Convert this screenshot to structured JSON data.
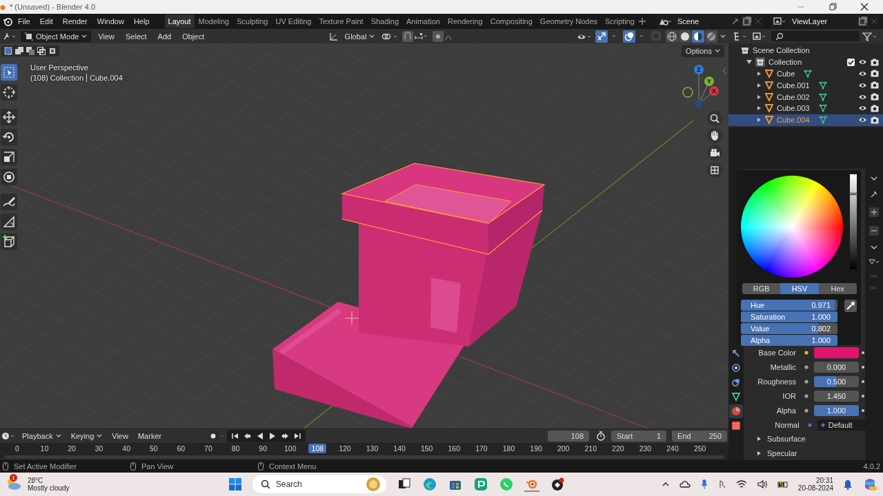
{
  "window": {
    "title": "* (Unsaved) - Blender 4.0"
  },
  "menus": [
    "File",
    "Edit",
    "Render",
    "Window",
    "Help"
  ],
  "workspaces": [
    {
      "label": "Layout",
      "selected": true
    },
    {
      "label": "Modeling",
      "selected": false
    },
    {
      "label": "Sculpting",
      "selected": false
    },
    {
      "label": "UV Editing",
      "selected": false
    },
    {
      "label": "Texture Paint",
      "selected": false
    },
    {
      "label": "Shading",
      "selected": false
    },
    {
      "label": "Animation",
      "selected": false
    },
    {
      "label": "Rendering",
      "selected": false
    },
    {
      "label": "Compositing",
      "selected": false
    },
    {
      "label": "Geometry Nodes",
      "selected": false
    },
    {
      "label": "Scripting",
      "selected": false
    }
  ],
  "scene": "Scene",
  "view_layer": "ViewLayer",
  "viewport_header": {
    "mode": "Object Mode",
    "menus": [
      "View",
      "Select",
      "Add",
      "Object"
    ],
    "orientation": "Global",
    "shading_modes": [
      {
        "kind": "wireframe",
        "selected": false
      },
      {
        "kind": "solid",
        "selected": false
      },
      {
        "kind": "material",
        "selected": true
      },
      {
        "kind": "rendered",
        "selected": false
      }
    ]
  },
  "viewport": {
    "perspective": "User Perspective",
    "collection": "(108) Collection",
    "object": "Cube.004",
    "options": "Options",
    "gizmo_axes": [
      "Z",
      "Y",
      "X"
    ],
    "tools": [
      {
        "kind": "select",
        "selected": true
      },
      {
        "kind": "cursor",
        "selected": false
      },
      {
        "kind": "move",
        "selected": false
      },
      {
        "kind": "rotate",
        "selected": false
      },
      {
        "kind": "scale",
        "selected": false
      },
      {
        "kind": "transform",
        "selected": false
      },
      {
        "kind": "annotate",
        "selected": false
      },
      {
        "kind": "measure",
        "selected": false
      },
      {
        "kind": "add-cube",
        "selected": false
      }
    ]
  },
  "outliner": {
    "root": "Scene Collection",
    "collections": [
      {
        "label": "Collection",
        "expanded": true,
        "checked": true,
        "children": [
          {
            "label": "Cube",
            "expanded": false,
            "selected": false
          },
          {
            "label": "Cube.001",
            "expanded": false,
            "selected": false
          },
          {
            "label": "Cube.002",
            "expanded": false,
            "selected": false
          },
          {
            "label": "Cube.003",
            "expanded": false,
            "selected": false
          },
          {
            "label": "Cube.004",
            "expanded": false,
            "selected": true
          }
        ]
      }
    ]
  },
  "color_picker": {
    "modes": [
      {
        "label": "RGB",
        "selected": false
      },
      {
        "label": "HSV",
        "selected": true
      },
      {
        "label": "Hex",
        "selected": false
      }
    ],
    "fields": [
      {
        "label": "Hue",
        "value": "0.971",
        "level": 0.971
      },
      {
        "label": "Saturation",
        "value": "1.000",
        "level": 1
      },
      {
        "label": "Value",
        "value": "0.802",
        "level": 0.802
      },
      {
        "label": "Alpha",
        "value": "1.000",
        "level": 1
      }
    ]
  },
  "material": [
    {
      "label": "Base Color",
      "kind": "color",
      "color": "#e0146e"
    },
    {
      "label": "Metallic",
      "kind": "slider",
      "value": "0.000",
      "level": 0
    },
    {
      "label": "Roughness",
      "kind": "slider",
      "value": "0.500",
      "level": 0.5
    },
    {
      "label": "IOR",
      "kind": "number",
      "value": "1.450"
    },
    {
      "label": "Alpha",
      "kind": "slider",
      "value": "1.000",
      "level": 1
    },
    {
      "label": "Normal",
      "kind": "menu",
      "value": "Default"
    }
  ],
  "sections": [
    {
      "label": "Subsurface",
      "expanded": false
    },
    {
      "label": "Specular",
      "expanded": false
    }
  ],
  "timeline": {
    "menus": [
      {
        "label": "Playback",
        "dropdown": true
      },
      {
        "label": "Keying",
        "dropdown": true
      },
      {
        "label": "View",
        "dropdown": false
      },
      {
        "label": "Marker",
        "dropdown": false
      }
    ],
    "current": "108",
    "start_label": "Start",
    "start": "1",
    "end_label": "End",
    "end": "250",
    "ticks": [
      {
        "label": "0",
        "selected": false
      },
      {
        "label": "10",
        "selected": false
      },
      {
        "label": "20",
        "selected": false
      },
      {
        "label": "30",
        "selected": false
      },
      {
        "label": "40",
        "selected": false
      },
      {
        "label": "50",
        "selected": false
      },
      {
        "label": "60",
        "selected": false
      },
      {
        "label": "70",
        "selected": false
      },
      {
        "label": "80",
        "selected": false
      },
      {
        "label": "90",
        "selected": false
      },
      {
        "label": "100",
        "selected": false
      },
      {
        "label": "108",
        "selected": true
      },
      {
        "label": "120",
        "selected": false
      },
      {
        "label": "130",
        "selected": false
      },
      {
        "label": "140",
        "selected": false
      },
      {
        "label": "150",
        "selected": false
      },
      {
        "label": "160",
        "selected": false
      },
      {
        "label": "170",
        "selected": false
      },
      {
        "label": "180",
        "selected": false
      },
      {
        "label": "190",
        "selected": false
      },
      {
        "label": "200",
        "selected": false
      },
      {
        "label": "210",
        "selected": false
      },
      {
        "label": "220",
        "selected": false
      },
      {
        "label": "230",
        "selected": false
      },
      {
        "label": "240",
        "selected": false
      },
      {
        "label": "250",
        "selected": false
      }
    ]
  },
  "status_bar": {
    "hints": [
      "Set Active Modifier",
      "Pan View",
      "Context Menu"
    ],
    "version": "4.0.2"
  },
  "taskbar": {
    "temperature": "28°C",
    "weather": "Mostly cloudy",
    "badge": "1",
    "search": "Search",
    "time": "20:31",
    "date": "20-08-2024"
  }
}
